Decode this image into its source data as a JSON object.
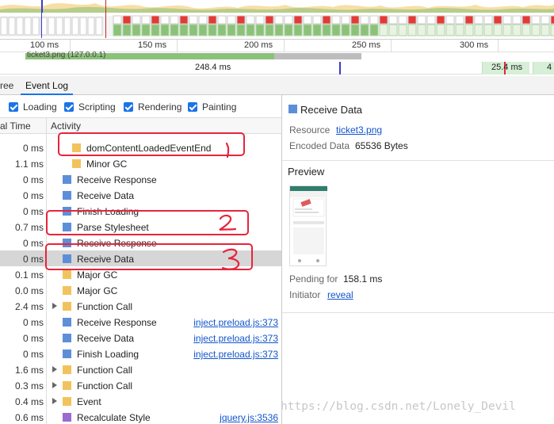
{
  "ruler": {
    "ticks": [
      "100 ms",
      "150 ms",
      "200 ms",
      "250 ms",
      "300 ms"
    ]
  },
  "network": {
    "request_label": "ticket3.png (127.0.0.1)"
  },
  "frames": {
    "duration_1": "248.4 ms",
    "duration_2": "25.4 ms",
    "duration_3": "4"
  },
  "tabs": [
    {
      "label": "ree",
      "active": false
    },
    {
      "label": "Event Log",
      "active": true
    }
  ],
  "filters": [
    {
      "label": "Loading",
      "checked": true
    },
    {
      "label": "Scripting",
      "checked": true
    },
    {
      "label": "Rendering",
      "checked": true
    },
    {
      "label": "Painting",
      "checked": true
    }
  ],
  "table": {
    "col_time": "al Time",
    "col_activity": "Activity",
    "rows": [
      {
        "time": "0 ms",
        "name": "domContentLoadedEventEnd",
        "color": "yellow",
        "indent": 1,
        "expandable": false,
        "link": ""
      },
      {
        "time": "1.1 ms",
        "name": "Minor GC",
        "color": "yellow",
        "indent": 1,
        "expandable": false,
        "link": ""
      },
      {
        "time": "0 ms",
        "name": "Receive Response",
        "color": "blue",
        "indent": 0,
        "expandable": false,
        "link": ""
      },
      {
        "time": "0 ms",
        "name": "Receive Data",
        "color": "blue",
        "indent": 0,
        "expandable": false,
        "link": ""
      },
      {
        "time": "0 ms",
        "name": "Finish Loading",
        "color": "blue",
        "indent": 0,
        "expandable": false,
        "link": ""
      },
      {
        "time": "0.7 ms",
        "name": "Parse Stylesheet",
        "color": "blue",
        "indent": 0,
        "expandable": false,
        "link": ""
      },
      {
        "time": "0 ms",
        "name": "Receive Response",
        "color": "blue",
        "indent": 0,
        "expandable": false,
        "link": ""
      },
      {
        "time": "0 ms",
        "name": "Receive Data",
        "color": "blue",
        "indent": 0,
        "expandable": false,
        "link": "",
        "selected": true
      },
      {
        "time": "0.1 ms",
        "name": "Major GC",
        "color": "yellow",
        "indent": 0,
        "expandable": false,
        "link": ""
      },
      {
        "time": "0.0 ms",
        "name": "Major GC",
        "color": "yellow",
        "indent": 0,
        "expandable": false,
        "link": ""
      },
      {
        "time": "2.4 ms",
        "name": "Function Call",
        "color": "yellow",
        "indent": 0,
        "expandable": true,
        "link": ""
      },
      {
        "time": "0 ms",
        "name": "Receive Response",
        "color": "blue",
        "indent": 0,
        "expandable": false,
        "link": "inject.preload.js:373"
      },
      {
        "time": "0 ms",
        "name": "Receive Data",
        "color": "blue",
        "indent": 0,
        "expandable": false,
        "link": "inject.preload.js:373"
      },
      {
        "time": "0 ms",
        "name": "Finish Loading",
        "color": "blue",
        "indent": 0,
        "expandable": false,
        "link": "inject.preload.js:373"
      },
      {
        "time": "1.6 ms",
        "name": "Function Call",
        "color": "yellow",
        "indent": 0,
        "expandable": true,
        "link": ""
      },
      {
        "time": "0.3 ms",
        "name": "Function Call",
        "color": "yellow",
        "indent": 0,
        "expandable": true,
        "link": ""
      },
      {
        "time": "0.4 ms",
        "name": "Event",
        "color": "yellow",
        "indent": 0,
        "expandable": true,
        "link": ""
      },
      {
        "time": "0.6 ms",
        "name": "Recalculate Style",
        "color": "purple",
        "indent": 0,
        "expandable": false,
        "link": "jquery.js:3536"
      }
    ]
  },
  "details": {
    "title": "Receive Data",
    "resource_key": "Resource",
    "resource_val": "ticket3.png",
    "encoded_key": "Encoded Data",
    "encoded_val": "65536 Bytes",
    "preview_title": "Preview",
    "pending_key": "Pending for",
    "pending_val": "158.1 ms",
    "initiator_key": "Initiator",
    "initiator_val": "reveal"
  },
  "watermark": "https://blog.csdn.net/Lonely_Devil",
  "colors": {
    "accent": "#1a73e8",
    "loading": "#5d8fd8",
    "scripting": "#f2c35c",
    "rendering": "#9b6bd1",
    "annotation": "#e8243c"
  }
}
